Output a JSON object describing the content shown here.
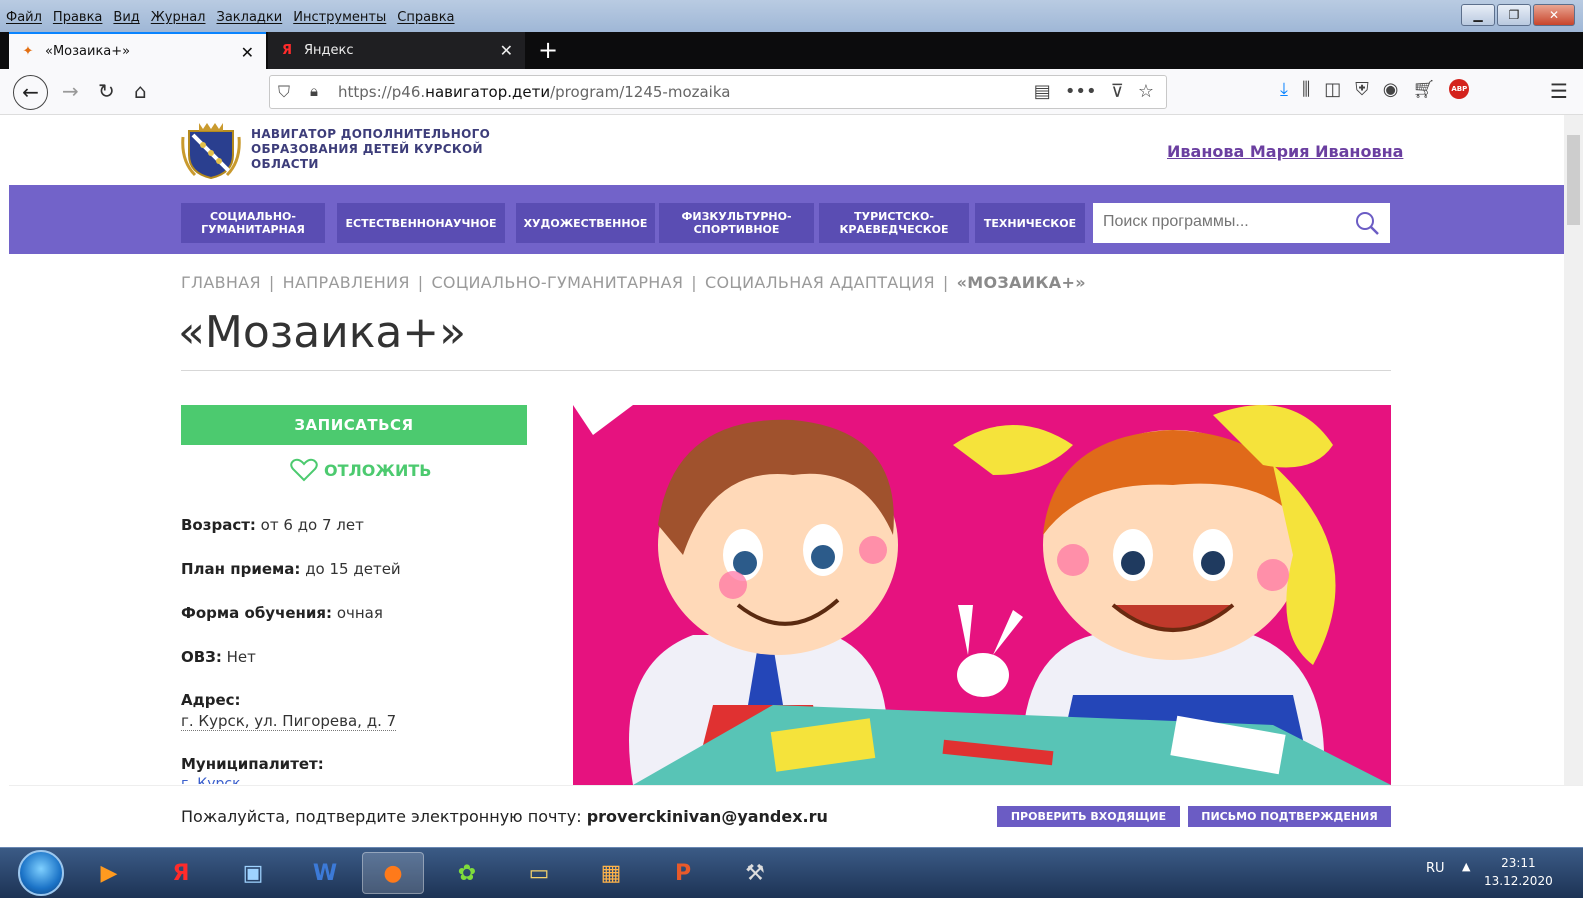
{
  "browser": {
    "menu": [
      "Файл",
      "Правка",
      "Вид",
      "Журнал",
      "Закладки",
      "Инструменты",
      "Справка"
    ],
    "tabs": [
      {
        "title": "«Мозаика+»",
        "icon": "mozaika-favicon-icon"
      },
      {
        "title": "Яндекс",
        "icon": "yandex-favicon-icon"
      }
    ],
    "url_prefix": "https://p46.",
    "url_domain": "навигатор.дети",
    "url_path": "/program/1245-mozaika"
  },
  "site": {
    "name_line1": "НАВИГАТОР ДОПОЛНИТЕЛЬНОГО",
    "name_line2": "ОБРАЗОВАНИЯ ДЕТЕЙ КУРСКОЙ",
    "name_line3": "ОБЛАСТИ",
    "user": "Иванова Мария Ивановна"
  },
  "nav": {
    "categories": [
      {
        "line1": "СОЦИАЛЬНО-",
        "line2": "ГУМАНИТАРНАЯ"
      },
      {
        "line1": "ЕСТЕСТВЕННОНАУЧНОЕ",
        "line2": ""
      },
      {
        "line1": "ХУДОЖЕСТВЕННОЕ",
        "line2": ""
      },
      {
        "line1": "ФИЗКУЛЬТУРНО-",
        "line2": "СПОРТИВНОЕ"
      },
      {
        "line1": "ТУРИСТСКО-",
        "line2": "КРАЕВЕДЧЕСКОЕ"
      },
      {
        "line1": "ТЕХНИЧЕСКОЕ",
        "line2": ""
      }
    ],
    "search_placeholder": "Поиск программы..."
  },
  "breadcrumb": [
    "ГЛАВНАЯ",
    "НАПРАВЛЕНИЯ",
    "СОЦИАЛЬНО-ГУМАНИТАРНАЯ",
    "СОЦИАЛЬНАЯ АДАПТАЦИЯ",
    "«МОЗАИКА+»"
  ],
  "program": {
    "title": "«Мозаика+»",
    "enroll": "ЗАПИСАТЬСЯ",
    "postpone": "ОТЛОЖИТЬ",
    "age_label": "Возраст:",
    "age_value": " от 6 до 7 лет",
    "plan_label": "План приема:",
    "plan_value": " до 15 детей",
    "form_label": "Форма обучения:",
    "form_value": " очная",
    "ovz_label": "ОВЗ:",
    "ovz_value": " Нет",
    "address_label": "Адрес:",
    "address_value": "г. Курск, ул. Пигорева, д. 7",
    "municipality_label": "Муниципалитет:",
    "municipality_value": "г. Курск"
  },
  "confirm": {
    "text": "Пожалуйста, подтвердите электронную почту: ",
    "email": "proverckinivan@yandex.ru",
    "check_inbox": "ПРОВЕРИТЬ ВХОДЯЩИЕ",
    "confirm_letter": "ПИСЬМО ПОДТВЕРЖДЕНИЯ"
  },
  "taskbar": {
    "lang": "RU",
    "time": "23:11",
    "date": "13.12.2020"
  },
  "colors": {
    "accent_purple": "#7263c9",
    "green": "#4cca6f",
    "hero_pink": "#e6127f"
  }
}
